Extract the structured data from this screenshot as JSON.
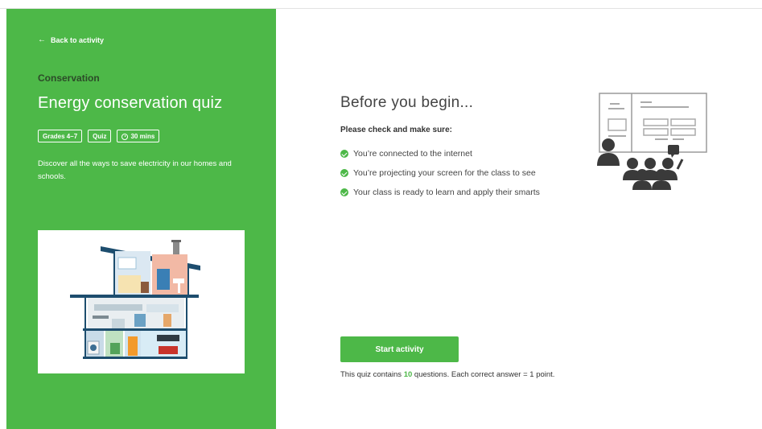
{
  "sidebar": {
    "back_label": "Back to activity",
    "category": "Conservation",
    "title": "Energy conservation quiz",
    "badges": {
      "grades": "Grades 4–7",
      "type": "Quiz",
      "duration": "30 mins"
    },
    "description": "Discover all the ways to save electricity in our homes and schools.",
    "illustration_icon": "house-cutaway-illustration"
  },
  "main": {
    "heading": "Before you begin...",
    "subheading": "Please check and make sure:",
    "checklist": [
      "You’re connected to the internet",
      "You’re projecting your screen for the class to see",
      "Your class is ready to learn and apply their smarts"
    ],
    "illustration_icon": "classroom-presentation-illustration",
    "start_label": "Start activity",
    "info": {
      "prefix": "This quiz contains ",
      "count": "10",
      "suffix": " questions. Each correct answer = 1 point."
    }
  },
  "colors": {
    "brand_green": "#4db848",
    "category_text": "#2c4a28"
  }
}
